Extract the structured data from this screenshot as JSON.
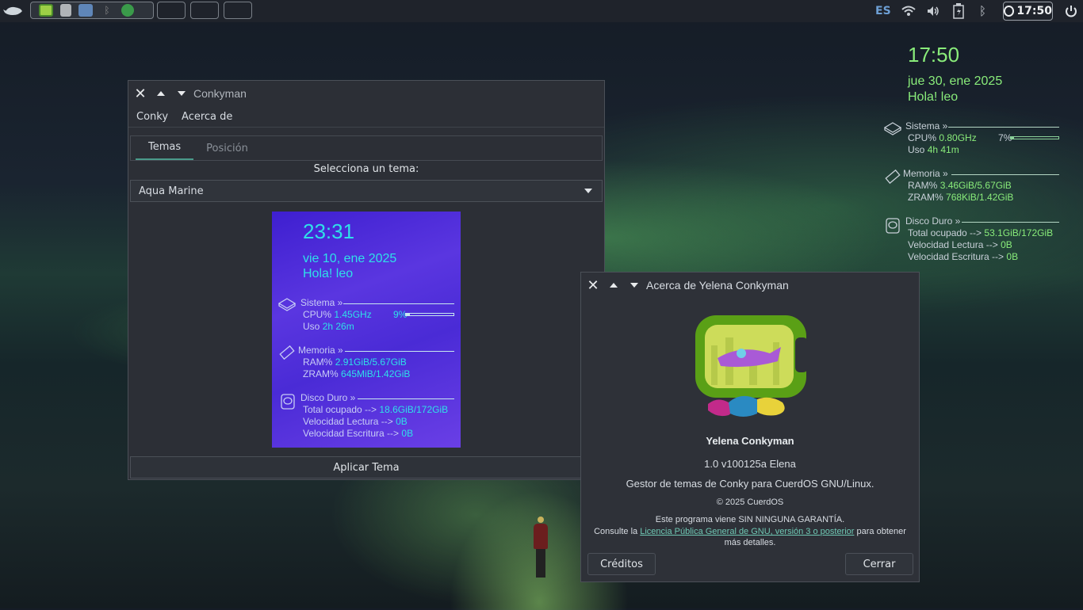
{
  "panel": {
    "keyboard_layout": "ES",
    "clock": "17:50",
    "icons": [
      "menu-logo-icon",
      "chat-app-icon",
      "text-editor-icon",
      "file-manager-icon",
      "bluetooth-app-icon",
      "spotify-icon",
      "wifi-icon",
      "volume-icon",
      "battery-icon",
      "bluetooth-icon",
      "clock-icon",
      "power-icon"
    ]
  },
  "desktop_conky": {
    "time": "17:50",
    "date": "jue 30, ene 2025",
    "greeting": "Hola! leo",
    "system": {
      "title": "Sistema »",
      "cpu_label": "CPU%",
      "cpu_freq": "0.80GHz",
      "cpu_percent": "7%",
      "cpu_fraction": 0.07,
      "uptime_label": "Uso",
      "uptime": "4h 41m"
    },
    "memory": {
      "title": "Memoria »",
      "ram_label": "RAM%",
      "ram": "3.46GiB/5.67GiB",
      "zram_label": "ZRAM%",
      "zram": "768KiB/1.42GiB"
    },
    "disk": {
      "title": "Disco Duro »",
      "total_label": "Total ocupado -->",
      "total": "53.1GiB/172GiB",
      "read_label": "Velocidad Lectura -->",
      "read": "0B",
      "write_label": "Velocidad Escritura -->",
      "write": "0B"
    },
    "color": "#89ec7a"
  },
  "conkyman": {
    "title": "Conkyman",
    "menu": [
      "Conky",
      "Acerca de"
    ],
    "tabs": [
      "Temas",
      "Posición"
    ],
    "select_label": "Selecciona un tema:",
    "selected_theme": "Aqua Marine",
    "preview": {
      "time": "23:31",
      "date": "vie 10, ene 2025",
      "greeting": "Hola! leo",
      "system": {
        "title": "Sistema »",
        "cpu_label": "CPU%",
        "cpu_freq": "1.45GHz",
        "cpu_percent": "9%",
        "cpu_fraction": 0.09,
        "uptime_label": "Uso",
        "uptime": "2h 26m"
      },
      "memory": {
        "title": "Memoria »",
        "ram_label": "RAM%",
        "ram": "2.91GiB/5.67GiB",
        "zram_label": "ZRAM%",
        "zram": "645MiB/1.42GiB"
      },
      "disk": {
        "title": "Disco Duro »",
        "total_label": "Total ocupado -->",
        "total": "18.6GiB/172GiB",
        "read_label": "Velocidad Lectura -->",
        "read": "0B",
        "write_label": "Velocidad Escritura -->",
        "write": "0B"
      }
    },
    "apply_label": "Aplicar Tema"
  },
  "about": {
    "title": "Acerca de Yelena Conkyman",
    "app_name": "Yelena Conkyman",
    "version": "1.0 v100125a Elena",
    "description": "Gestor de temas de Conky para CuerdOS GNU/Linux.",
    "copyright": "© 2025 CuerdOS",
    "warranty": "Este programa viene SIN NINGUNA GARANTÍA.",
    "license_prefix": "Consulte la",
    "license_link": "Licencia Pública General de GNU, versión 3 o posterior",
    "license_suffix": "para obtener",
    "license_suffix2": "más detalles.",
    "credits_label": "Créditos",
    "close_label": "Cerrar"
  }
}
